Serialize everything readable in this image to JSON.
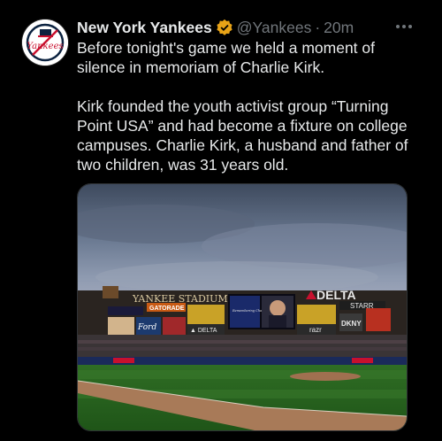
{
  "account": {
    "display_name": "New York Yankees",
    "handle": "@Yankees",
    "separator": "·",
    "time": "20m",
    "avatar_icon": "yankees-logo",
    "verified_color": "#e8a317"
  },
  "tweet": {
    "paragraph_1": "Before tonight's game we held a moment of silence in memoriam of Charlie Kirk.",
    "paragraph_2": "Kirk founded the youth activist group “Turning Point USA” and had become a fixture on college campuses. Charlie Kirk, a husband and father of two children, was 31 years old."
  },
  "photo": {
    "stadium_sign": "YANKEE STADIUM",
    "sponsor_delta": "DELTA",
    "sponsor_starr": "STARR",
    "sponsor_gatorade": "GATORADE",
    "sponsor_ford": "Ford",
    "sponsor_dkny": "DKNY",
    "sponsor_razr": "razr",
    "memorial_text": "Remembering Charlie Kirk"
  },
  "more_icon": "more-horizontal-icon"
}
